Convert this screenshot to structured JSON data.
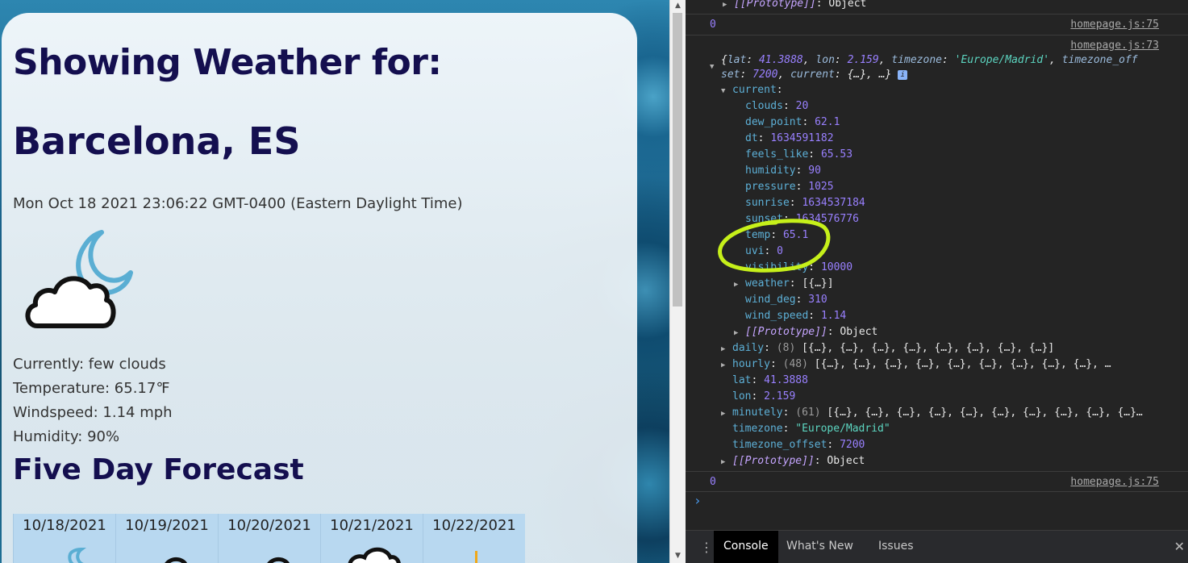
{
  "page": {
    "title": "Showing Weather for:",
    "city": "Barcelona, ES",
    "date": "Mon Oct 18 2021 23:06:22 GMT-0400 (Eastern Daylight Time)",
    "current_icon": "moon-cloud-icon",
    "details": {
      "currently": "Currently: few clouds",
      "temperature": "Temperature: 65.17℉",
      "windspeed": "Windspeed: 1.14 mph",
      "humidity": "Humidity: 90%"
    },
    "forecast_title": "Five Day Forecast",
    "forecast": [
      {
        "date": "10/18/2021",
        "icon": "moon-icon"
      },
      {
        "date": "10/19/2021",
        "icon": "cloud-icon"
      },
      {
        "date": "10/20/2021",
        "icon": "cloud-icon"
      },
      {
        "date": "10/21/2021",
        "icon": "cloud-icon"
      },
      {
        "date": "10/22/2021",
        "icon": "sun-icon"
      }
    ]
  },
  "devtools": {
    "top_prototype": "[[Prototype]]",
    "top_object": "Object",
    "log_zero_1": "0",
    "src_75": "homepage.js:75",
    "src_73": "homepage.js:73",
    "summary_line1": {
      "lat_key": "lat",
      "lat": "41.3888",
      "lon_key": "lon",
      "lon": "2.159",
      "tz_key": "timezone",
      "tz": "'Europe/Madrid'",
      "tzo_key": "timezone_off"
    },
    "summary_line2": {
      "tzo_rest": "set",
      "tzo": "7200",
      "current_key": "current",
      "current": "{…}",
      "tail": "…}"
    },
    "current_key": "current",
    "current_props": [
      {
        "key": "clouds",
        "value": "20"
      },
      {
        "key": "dew_point",
        "value": "62.1"
      },
      {
        "key": "dt",
        "value": "1634591182"
      },
      {
        "key": "feels_like",
        "value": "65.53"
      },
      {
        "key": "humidity",
        "value": "90"
      },
      {
        "key": "pressure",
        "value": "1025"
      },
      {
        "key": "sunrise",
        "value": "1634537184"
      },
      {
        "key": "sunset",
        "value": "1634576776"
      },
      {
        "key": "temp",
        "value": "65.1"
      },
      {
        "key": "uvi",
        "value": "0"
      },
      {
        "key": "visibility",
        "value": "10000"
      },
      {
        "key": "weather",
        "value": "[{…}]"
      },
      {
        "key": "wind_deg",
        "value": "310"
      },
      {
        "key": "wind_speed",
        "value": "1.14"
      },
      {
        "key": "[[Prototype]]",
        "value": "Object"
      }
    ],
    "root_props": [
      {
        "key": "daily",
        "count": "(8)",
        "value": "[{…}, {…}, {…}, {…}, {…}, {…}, {…}, {…}]"
      },
      {
        "key": "hourly",
        "count": "(48)",
        "value": "[{…}, {…}, {…}, {…}, {…}, {…}, {…}, {…}, {…}, …"
      },
      {
        "key": "lat",
        "value": "41.3888"
      },
      {
        "key": "lon",
        "value": "2.159"
      },
      {
        "key": "minutely",
        "count": "(61)",
        "value": "[{…}, {…}, {…}, {…}, {…}, {…}, {…}, {…}, {…}, {…}…"
      },
      {
        "key": "timezone",
        "value": "\"Europe/Madrid\""
      },
      {
        "key": "timezone_offset",
        "value": "7200"
      },
      {
        "key": "[[Prototype]]",
        "value": "Object"
      }
    ],
    "log_zero_2": "0",
    "prompt": "›",
    "tabs": [
      "Console",
      "What's New",
      "Issues"
    ],
    "menu_icon": "kebab-menu-icon",
    "close_icon": "close-icon",
    "highlight_color": "#c6f01a"
  }
}
